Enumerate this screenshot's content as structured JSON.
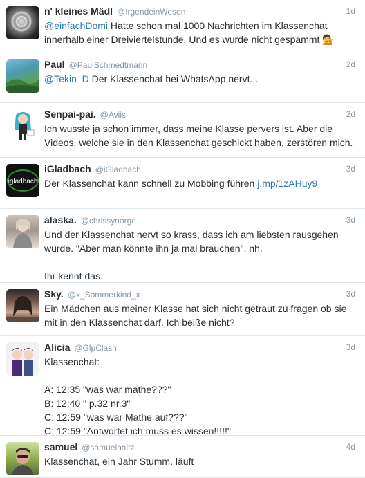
{
  "tweets": [
    {
      "name": "n' kleines Mädl",
      "handle": "@IrgendeinWesen",
      "time": "1d",
      "avatar_icon": "dark-rose-avatar",
      "lines": [
        {
          "mention": "@einfachDomi",
          "text": " Hatte schon mal 1000 Nachrichten im Klassenchat"
        },
        {
          "text": "innerhalb einer Dreiviertelstunde. Und es wurde nicht gespammt 💁"
        }
      ]
    },
    {
      "name": "Paul",
      "handle": "@PaulSchmedtmann",
      "time": "2d",
      "avatar_icon": "landscape-avatar",
      "lines": [
        {
          "mention": "@Tekin_D",
          "text": " Der Klassenchat bei WhatsApp nervt..."
        }
      ]
    },
    {
      "name": "Senpai-pai.",
      "handle": "@Aviis",
      "time": "2d",
      "avatar_icon": "anime-character-avatar",
      "lines": [
        {
          "text": "Ich wusste ja schon immer, dass meine Klasse pervers ist. Aber die"
        },
        {
          "text": "Videos, welche sie in den Klassenchat geschickt haben, zerstören mich."
        }
      ]
    },
    {
      "name": "iGladbach",
      "handle": "@iGladbach",
      "time": "3d",
      "avatar_icon": "igladbach-logo-avatar",
      "avatar_text": "igladbach",
      "lines": [
        {
          "text": "Der Klassenchat kann schnell zu Mobbing führen ",
          "link": "j.mp/1zAHuy9"
        }
      ]
    },
    {
      "name": "alaska.",
      "handle": "@chrissynorge",
      "time": "3d",
      "avatar_icon": "person-photo-avatar",
      "lines": [
        {
          "text": "Und der Klassenchat nervt so krass, dass ich am liebsten rausgehen"
        },
        {
          "text": "würde. \"Aber man könnte ihn ja mal brauchen\", nh."
        },
        {
          "blank": true
        },
        {
          "text": "Ihr kennt das."
        }
      ]
    },
    {
      "name": "Sky.",
      "handle": "@x_Sommerkind_x",
      "time": "3d",
      "avatar_icon": "person-photo-avatar",
      "lines": [
        {
          "text": "Ein Mädchen aus meiner Klasse hat sich nicht getraut zu fragen ob sie"
        },
        {
          "text": "mit in den Klassenchat darf. Ich beiße nicht?"
        }
      ]
    },
    {
      "name": "Alicia",
      "handle": "@GlpClash",
      "time": "3d",
      "avatar_icon": "anime-duo-avatar",
      "lines": [
        {
          "text": "Klassenchat:"
        },
        {
          "blank": true
        },
        {
          "text": "A: 12:35 \"was war mathe???\""
        },
        {
          "text": "B: 12:40 \" p.32 nr.3\""
        },
        {
          "text": "C: 12:59 \"was war Mathe auf???\""
        },
        {
          "text": "C: 12:59 \"Antwortet ich muss es wissen!!!!!\""
        }
      ]
    },
    {
      "name": "samuel",
      "handle": "@samuelhaitz",
      "time": "4d",
      "avatar_icon": "selfie-avatar",
      "lines": [
        {
          "text": "Klassenchat, ein Jahr Stumm. läuft"
        }
      ]
    }
  ]
}
